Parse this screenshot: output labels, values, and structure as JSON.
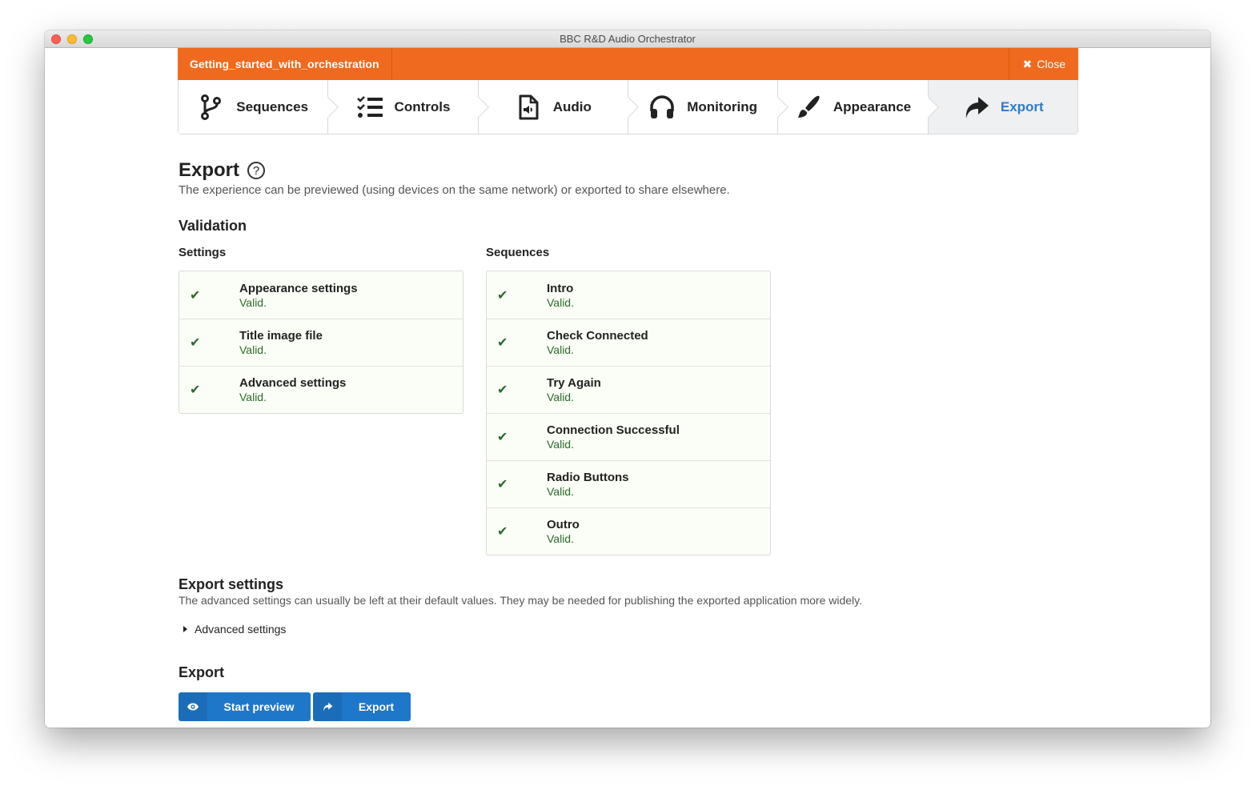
{
  "window": {
    "title": "BBC R&D Audio Orchestrator"
  },
  "topbar": {
    "project_name": "Getting_started_with_orchestration",
    "close_label": "Close"
  },
  "steps": [
    {
      "label": "Sequences",
      "icon": "branch-icon",
      "active": false
    },
    {
      "label": "Controls",
      "icon": "checklist-icon",
      "active": false
    },
    {
      "label": "Audio",
      "icon": "audio-file-icon",
      "active": false
    },
    {
      "label": "Monitoring",
      "icon": "headphones-icon",
      "active": false
    },
    {
      "label": "Appearance",
      "icon": "paintbrush-icon",
      "active": false
    },
    {
      "label": "Export",
      "icon": "share-arrow-icon",
      "active": true
    }
  ],
  "page": {
    "title": "Export",
    "help_icon": "?",
    "description": "The experience can be previewed (using devices on the same network) or exported to share elsewhere."
  },
  "validation": {
    "heading": "Validation",
    "settings": {
      "heading": "Settings",
      "items": [
        {
          "name": "Appearance settings",
          "status": "Valid."
        },
        {
          "name": "Title image file",
          "status": "Valid."
        },
        {
          "name": "Advanced settings",
          "status": "Valid."
        }
      ]
    },
    "sequences": {
      "heading": "Sequences",
      "items": [
        {
          "name": "Intro",
          "status": "Valid."
        },
        {
          "name": "Check Connected",
          "status": "Valid."
        },
        {
          "name": "Try Again",
          "status": "Valid."
        },
        {
          "name": "Connection Successful",
          "status": "Valid."
        },
        {
          "name": "Radio Buttons",
          "status": "Valid."
        },
        {
          "name": "Outro",
          "status": "Valid."
        }
      ]
    }
  },
  "export_settings": {
    "heading": "Export settings",
    "description": "The advanced settings can usually be left at their default values. They may be needed for publishing the exported application more widely.",
    "advanced_toggle": "Advanced settings"
  },
  "export_actions": {
    "heading": "Export",
    "preview_label": "Start preview",
    "export_label": "Export"
  },
  "colors": {
    "accent": "#ef6a1e",
    "primary": "#1f77c9",
    "valid": "#2a6a2b",
    "active_step": "#2f7bc7"
  }
}
